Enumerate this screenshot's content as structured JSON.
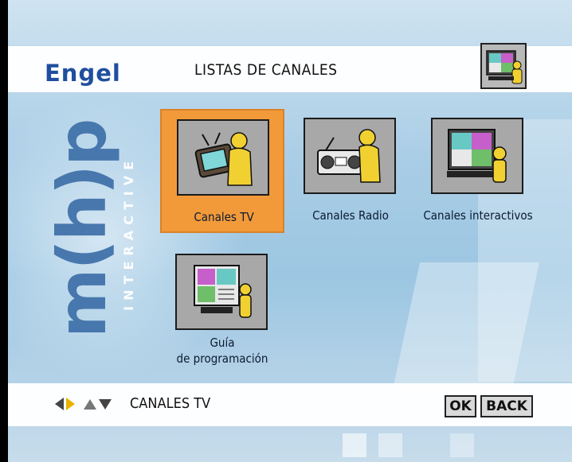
{
  "header": {
    "logo": "Engel",
    "title": "LISTAS DE CANALES"
  },
  "brand": {
    "letters": "m(h)p",
    "sub": "INTERACTIVE"
  },
  "menu": {
    "items": [
      {
        "label": "Canales TV",
        "icon": "tv-icon",
        "selected": true
      },
      {
        "label": "Canales Radio",
        "icon": "radio-icon",
        "selected": false
      },
      {
        "label": "Canales interactivos",
        "icon": "interactive-tv-icon",
        "selected": false
      },
      {
        "label_line1": "Guía",
        "label_line2": "de programación",
        "icon": "program-guide-icon",
        "selected": false
      }
    ]
  },
  "footer": {
    "current": "CANALES TV",
    "ok_label": "OK",
    "back_label": "BACK"
  },
  "colors": {
    "selected_tile": "#f29a3a",
    "logo": "#1f4f9e",
    "background": "#a9cde6"
  }
}
